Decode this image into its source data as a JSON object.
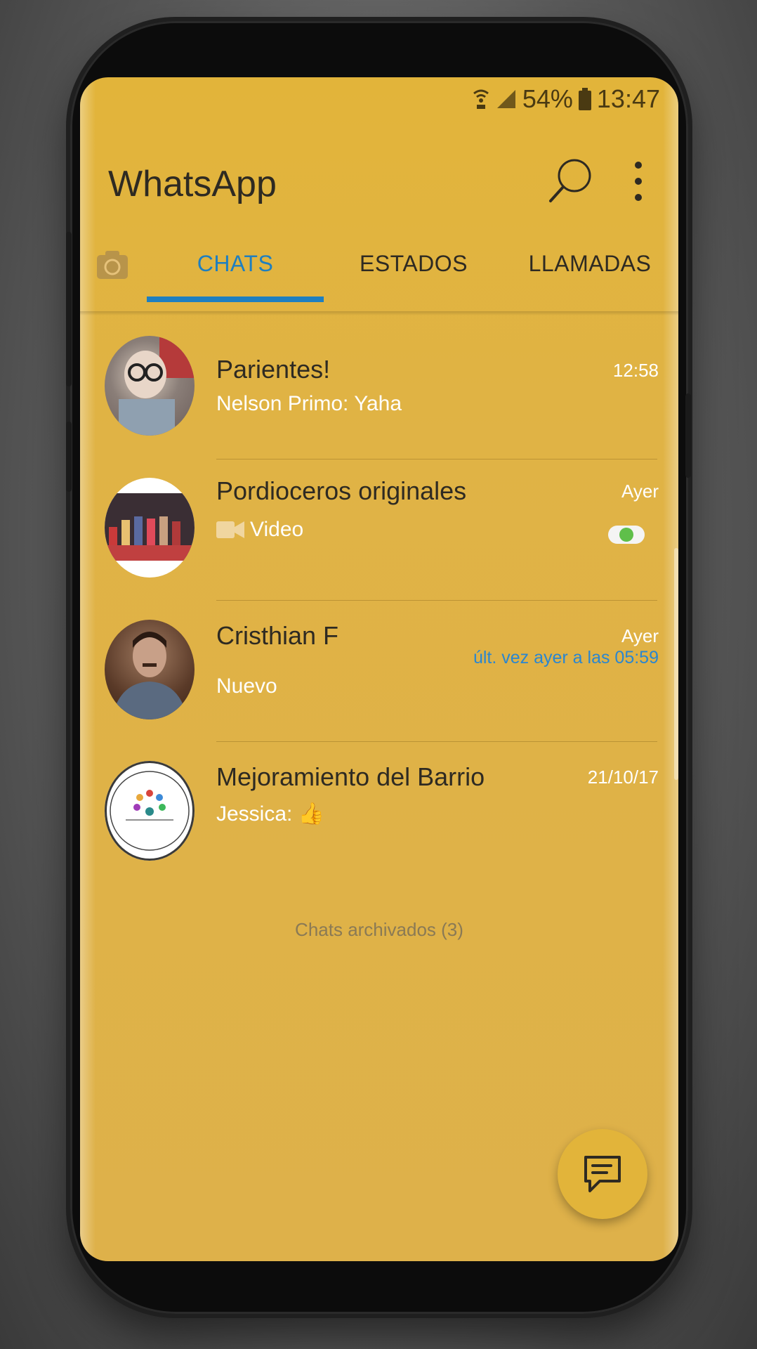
{
  "status_bar": {
    "battery": "54%",
    "time": "13:47"
  },
  "app": {
    "title": "WhatsApp"
  },
  "tabs": [
    {
      "label": "CHATS",
      "active": true
    },
    {
      "label": "ESTADOS",
      "active": false
    },
    {
      "label": "LLAMADAS",
      "active": false
    }
  ],
  "chats": [
    {
      "name": "Parientes!",
      "sender": "Nelson Primo:",
      "message": "Yaha",
      "time": "12:58"
    },
    {
      "name": "Pordioceros originales",
      "message": "Video",
      "time": "Ayer"
    },
    {
      "name": "Cristhian F",
      "message": "Nuevo",
      "time": "Ayer",
      "last_seen": "últ. vez ayer a las 05:59"
    },
    {
      "name": "Mejoramiento del Barrio",
      "sender": "Jessica:",
      "message": "👍",
      "time": "21/10/17"
    }
  ],
  "archived": "Chats archivados (3)",
  "colors": {
    "accent": "#1e7fc0",
    "background": "#e0b345",
    "title_text": "#2e2a22"
  },
  "icons": [
    "search-icon",
    "more-options-icon",
    "camera-icon",
    "video-icon",
    "new-chat-icon"
  ]
}
